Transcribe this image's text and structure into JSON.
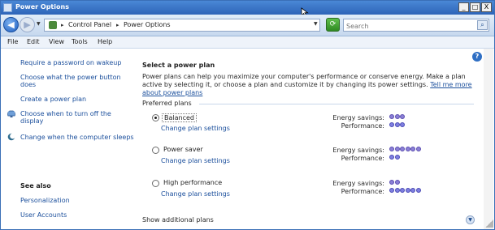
{
  "window": {
    "title": "Power Options"
  },
  "titlebar_buttons": {
    "minimize": "_",
    "maximize": "□",
    "close": "X"
  },
  "address": {
    "crumbs": [
      "Control Panel",
      "Power Options"
    ],
    "separator": "▸"
  },
  "search": {
    "placeholder": "Search"
  },
  "menu": [
    "File",
    "Edit",
    "View",
    "Tools",
    "Help"
  ],
  "sidebar": {
    "links": [
      {
        "label": "Require a password on wakeup",
        "icon": ""
      },
      {
        "label": "Choose what the power button does",
        "icon": ""
      },
      {
        "label": "Create a power plan",
        "icon": ""
      },
      {
        "label": "Choose when to turn off the display",
        "icon": "monitor-icon"
      },
      {
        "label": "Change when the computer sleeps",
        "icon": "moon-icon"
      }
    ],
    "see_also_title": "See also",
    "see_also": [
      "Personalization",
      "User Accounts"
    ]
  },
  "main": {
    "heading": "Select a power plan",
    "description": "Power plans can help you maximize your computer's performance or conserve energy. Make a plan active by selecting it, or choose a plan and customize it by changing its power settings.",
    "learn_more": "Tell me more about power plans",
    "group_label": "Preferred plans",
    "change_label": "Change plan settings",
    "energy_label": "Energy savings:",
    "perf_label": "Performance:",
    "plans": [
      {
        "name": "Balanced",
        "selected": true,
        "energy": 3,
        "performance": 3
      },
      {
        "name": "Power saver",
        "selected": false,
        "energy": 6,
        "performance": 2
      },
      {
        "name": "High performance",
        "selected": false,
        "energy": 2,
        "performance": 6
      }
    ],
    "show_additional": "Show additional plans"
  },
  "colors": {
    "accent": "#1b4f9c",
    "titlebar": "#2e64b8"
  }
}
